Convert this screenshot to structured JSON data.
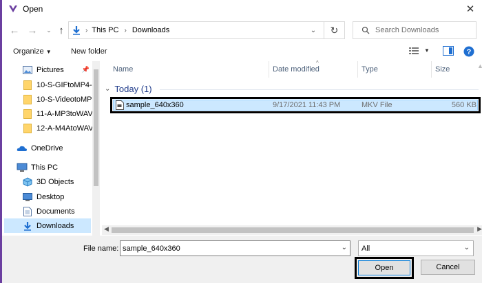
{
  "window": {
    "title": "Open"
  },
  "address": {
    "crumbs": [
      "This PC",
      "Downloads"
    ]
  },
  "search": {
    "placeholder": "Search Downloads"
  },
  "toolbar": {
    "organize_label": "Organize",
    "new_folder_label": "New folder"
  },
  "nav": {
    "items": [
      {
        "label": "Pictures",
        "icon": "pictures-icon"
      },
      {
        "label": "10-S-GIFtoMP4-",
        "icon": "folder-icon"
      },
      {
        "label": "10-S-VideotoMP",
        "icon": "folder-icon"
      },
      {
        "label": "11-A-MP3toWAV",
        "icon": "folder-icon"
      },
      {
        "label": "12-A-M4AtoWAV",
        "icon": "folder-icon"
      },
      {
        "label": "OneDrive",
        "icon": "cloud-icon"
      },
      {
        "label": "This PC",
        "icon": "computer-icon"
      },
      {
        "label": "3D Objects",
        "icon": "cube-icon"
      },
      {
        "label": "Desktop",
        "icon": "desktop-icon"
      },
      {
        "label": "Documents",
        "icon": "document-icon"
      },
      {
        "label": "Downloads",
        "icon": "download-icon"
      }
    ]
  },
  "columns": {
    "name": "Name",
    "date": "Date modified",
    "type": "Type",
    "size": "Size"
  },
  "group": {
    "label": "Today (1)"
  },
  "files": [
    {
      "name": "sample_640x360",
      "date": "9/17/2021 11:43 PM",
      "type": "MKV File",
      "size": "560 KB"
    }
  ],
  "bottom": {
    "file_name_label": "File name:",
    "file_name_value": "sample_640x360",
    "file_type_value": "All",
    "open_label": "Open",
    "cancel_label": "Cancel"
  },
  "colors": {
    "accent": "#0078d7",
    "selection": "#cce8ff",
    "window_edge": "#6b3fa0"
  }
}
